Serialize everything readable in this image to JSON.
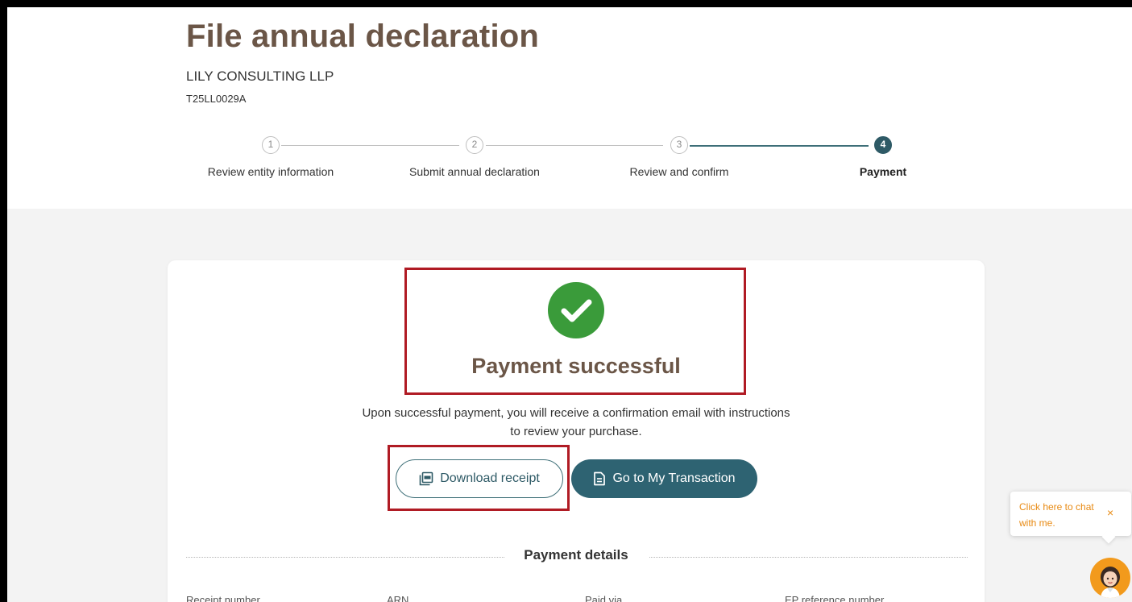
{
  "page": {
    "title": "File annual declaration",
    "entity_name": "LILY CONSULTING LLP",
    "entity_uen": "T25LL0029A"
  },
  "stepper": {
    "steps": [
      {
        "number": "1",
        "label": "Review entity information",
        "state": "done"
      },
      {
        "number": "2",
        "label": "Submit annual declaration",
        "state": "done"
      },
      {
        "number": "3",
        "label": "Review and confirm",
        "state": "done"
      },
      {
        "number": "4",
        "label": "Payment",
        "state": "active"
      }
    ]
  },
  "result": {
    "status_title": "Payment successful",
    "message": "Upon successful payment, you will receive a confirmation email with instructions to review your purchase.",
    "download_label": "Download receipt",
    "transaction_label": "Go to My Transaction"
  },
  "payment_details": {
    "title": "Payment details",
    "columns": [
      "Receipt number",
      "ARN",
      "Paid via",
      "EP reference number"
    ]
  },
  "chat": {
    "prompt": "Click here to chat with me.",
    "close": "×"
  },
  "colors": {
    "accent": "#2e6372",
    "heading": "#6b5647",
    "success": "#3a9b3a",
    "highlight": "#b01b24",
    "chat_accent": "#e88a13"
  }
}
